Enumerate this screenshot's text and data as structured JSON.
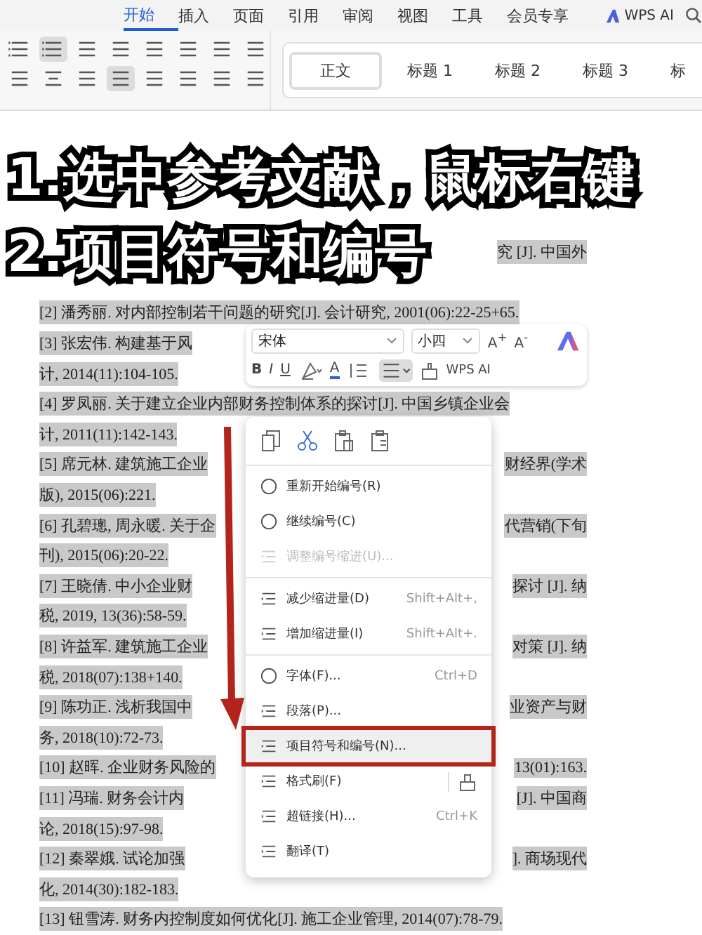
{
  "tabs": [
    {
      "label": "开始",
      "selected": true
    },
    {
      "label": "插入",
      "selected": false
    },
    {
      "label": "页面",
      "selected": false
    },
    {
      "label": "引用",
      "selected": false
    },
    {
      "label": "审阅",
      "selected": false
    },
    {
      "label": "视图",
      "selected": false
    },
    {
      "label": "工具",
      "selected": false
    },
    {
      "label": "会员专享",
      "selected": false
    }
  ],
  "ai_button": "WPS AI",
  "ribbon": {
    "numbered_list_active": true,
    "justify_active": true
  },
  "styles": [
    {
      "label": "正文",
      "selected": true
    },
    {
      "label": "标题 1",
      "selected": false
    },
    {
      "label": "标题 2",
      "selected": false
    },
    {
      "label": "标题 3",
      "selected": false
    },
    {
      "label": "标",
      "selected": false
    }
  ],
  "caption": {
    "lines": [
      "1.选中参考文献，鼠标右键",
      "2.项目符号和编号"
    ]
  },
  "doc": {
    "rows": [
      {
        "right": "究 [J]. 中国外",
        "selected": true
      },
      {
        "left": "[2] 潘秀丽. 对内部控制若干问题的研究[J]. 会计研究, 2001(06):22-25+65.",
        "selected": true
      },
      {
        "left": "[3] 张宏伟. 构建基于风",
        "selected": true
      },
      {
        "left": "计, 2014(11):104-105.",
        "selected": true
      },
      {
        "left": "[4] 罗凤丽. 关于建立企业内部财务控制体系的探讨[J]. 中国乡镇企业会",
        "selected": true
      },
      {
        "left": "计, 2011(11):142-143.",
        "selected": true
      },
      {
        "left": "[5] 席元林. 建筑施工企业",
        "right": "财经界(学术",
        "selected": true
      },
      {
        "left": "版), 2015(06):221.",
        "selected": true
      },
      {
        "left": "[6] 孔碧璁, 周永暖. 关于企",
        "right": "代营销(下旬",
        "selected": true
      },
      {
        "left": "刊), 2015(06):20-22.",
        "selected": true
      },
      {
        "left": "[7] 王晓倩. 中小企业财",
        "right": "探讨 [J]. 纳",
        "selected": true
      },
      {
        "left": "税, 2019, 13(36):58-59.",
        "selected": true
      },
      {
        "left": "[8] 许益军. 建筑施工企业",
        "right": "对策 [J]. 纳",
        "selected": true
      },
      {
        "left": "税, 2018(07):138+140.",
        "selected": true
      },
      {
        "left": "[9] 陈功正. 浅析我国中",
        "right": "业资产与财",
        "selected": true
      },
      {
        "left": "务, 2018(10):72-73.",
        "selected": true
      },
      {
        "left": "[10]  赵晖. 企业财务风险的",
        "right": "13(01):163.",
        "selected": true
      },
      {
        "left": "[11]  冯瑞. 财务会计内",
        "right": "[J]. 中国商",
        "selected": true
      },
      {
        "left": "论, 2018(15):97-98.",
        "selected": true
      },
      {
        "left": "[12]  秦翠娥. 试论加强",
        "right": "]. 商场现代",
        "selected": true
      },
      {
        "left": "化, 2014(30):182-183.",
        "selected": true
      },
      {
        "left": "[13]  钮雪涛. 财务内控制度如何优化[J]. 施工企业管理, 2014(07):78-79.",
        "selected": true
      }
    ]
  },
  "mini_toolbar": {
    "font": "宋体",
    "size": "小四",
    "grow": "A$^{+}$",
    "shrink": "A$^{-}$",
    "bold": "B",
    "italic": "I",
    "underline": "U",
    "font_color": "A",
    "align_active": true,
    "ai_label": "WPS AI"
  },
  "menu": {
    "groups": [
      [
        {
          "label": "重新开始编号(R)",
          "disabled": false,
          "selected": false,
          "framed": false
        },
        {
          "label": "继续编号(C)",
          "disabled": false,
          "selected": false,
          "framed": false
        },
        {
          "label": "调整编号缩进(U)...",
          "disabled": true,
          "selected": false,
          "framed": false
        }
      ],
      [
        {
          "label": "减少缩进量(D)",
          "shortcut": "Shift+Alt+,",
          "disabled": false,
          "selected": false,
          "framed": false
        },
        {
          "label": "增加缩进量(I)",
          "shortcut": "Shift+Alt+.",
          "disabled": false,
          "selected": false,
          "framed": false
        }
      ],
      [
        {
          "label": "字体(F)...",
          "shortcut": "Ctrl+D",
          "disabled": false,
          "selected": false,
          "framed": false
        },
        {
          "label": "段落(P)...",
          "disabled": false,
          "selected": false,
          "framed": false
        },
        {
          "label": "项目符号和编号(N)...",
          "disabled": false,
          "selected": true,
          "framed": true
        },
        {
          "label": "格式刷(F)",
          "disabled": false,
          "selected": false,
          "framed": false
        },
        {
          "label": "超链接(H)...",
          "shortcut": "Ctrl+K",
          "disabled": false,
          "selected": false,
          "framed": false
        },
        {
          "label": "翻译(T)",
          "disabled": false,
          "selected": false,
          "framed": false
        }
      ]
    ]
  }
}
